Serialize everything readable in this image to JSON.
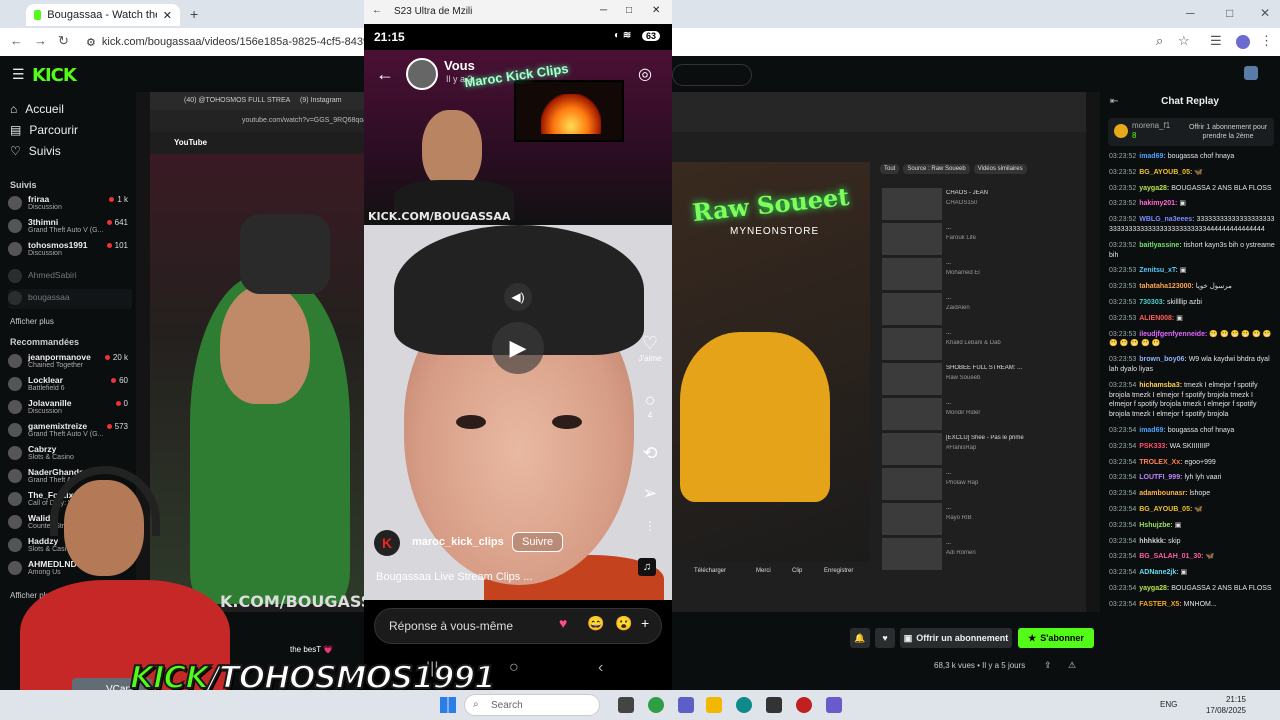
{
  "browser": {
    "tab1_title": "Bougassaa - Watch the VOD o",
    "url": "kick.com/bougassaa/videos/156e185a-9825-4cf5-8439-f83f774"
  },
  "kick": {
    "logo": "KICK",
    "nav": {
      "home": "Accueil",
      "browse": "Parcourir",
      "following": "Suivis"
    },
    "following_header": "Suivis",
    "following": [
      {
        "name": "friraa",
        "sub": "Discussion",
        "viewers": "1 k"
      },
      {
        "name": "3thimni",
        "sub": "Grand Theft Auto V (G...",
        "viewers": "641"
      },
      {
        "name": "tohosmos1991",
        "sub": "Discussion",
        "viewers": "101"
      },
      {
        "name": "AhmedSabiri",
        "sub": "",
        "viewers": ""
      },
      {
        "name": "bougassaa",
        "sub": "",
        "viewers": ""
      }
    ],
    "show_more": "Afficher plus",
    "recommended_header": "Recommandées",
    "recommended": [
      {
        "name": "jeanpormanove",
        "sub": "Chained Together",
        "viewers": "20 k"
      },
      {
        "name": "Locklear",
        "sub": "Battlefield 6",
        "viewers": "60"
      },
      {
        "name": "Jolavanille",
        "sub": "Discussion",
        "viewers": "0"
      },
      {
        "name": "gamemixtreize",
        "sub": "Grand Theft Auto V (G...",
        "viewers": "573"
      },
      {
        "name": "Cabrzy",
        "sub": "Slots & Casino",
        "viewers": ""
      },
      {
        "name": "NaderGhande",
        "sub": "Grand Theft Au",
        "viewers": ""
      },
      {
        "name": "The_Footix",
        "sub": "Call of Duty: W",
        "viewers": ""
      },
      {
        "name": "Walid",
        "sub": "Counter-Str",
        "viewers": ""
      },
      {
        "name": "Haddzy",
        "sub": "Slots & Casi",
        "viewers": ""
      },
      {
        "name": "AHMEDLNDY",
        "sub": "Among Us",
        "viewers": ""
      }
    ],
    "show_more2": "Afficher plus"
  },
  "inner_browser": {
    "tab1": "(40) @TOHOSMOS FULL STREA",
    "tab2": "(9) Instagram",
    "url": "youtube.com/watch?v=GGS_9RQ68qo&t",
    "yt_logo": "YouTube",
    "watermark": "K.COM/BOUGASSAA"
  },
  "right_window": {
    "neon": "Raw Soueet",
    "neon_sub": "MYNEONSTORE",
    "chips": [
      "Tout",
      "Source : Raw Soueeb",
      "Vidéos similaires"
    ],
    "list": [
      {
        "title": "CHAOS - JEAN",
        "meta": "CHAOS150"
      },
      {
        "title": "...",
        "meta": "Farouk Life"
      },
      {
        "title": "...",
        "meta": "Mohamed El"
      },
      {
        "title": "...",
        "meta": "ZaidAlen"
      },
      {
        "title": "...",
        "meta": "Khalid Lebani & Dab"
      },
      {
        "title": "SHOBEE FULL STREAM: ...",
        "meta": "Raw Soueeb"
      },
      {
        "title": "...",
        "meta": "Mondir Rider"
      },
      {
        "title": "[EXCLU] Shee - Pas le prime",
        "meta": "#FlanisRap"
      },
      {
        "title": "...",
        "meta": "Pholaw Rap"
      },
      {
        "title": "...",
        "meta": "Rayo RIB"
      },
      {
        "title": "...",
        "meta": "Adi Romen"
      }
    ],
    "bottom_actions": [
      "Télécharger",
      "Merci",
      "Clip",
      "Enregistrer"
    ]
  },
  "phone": {
    "window_title": "S23 Ultra de Mzili",
    "time": "21:15",
    "battery": "63",
    "story_user": "Vous",
    "story_time": "Il y a 2",
    "neon_sign": "Maroc Kick Clips",
    "cam_url": "KICK.COM/BOUGASSAA",
    "reel_author": "maroc_kick_clips",
    "follow": "Suivre",
    "caption": "Bougassaa Live Stream Clips ...",
    "like_label": "J'aime",
    "comment_count": "4",
    "reply_placeholder": "Réponse à vous-même"
  },
  "chat": {
    "title": "Chat Replay",
    "pinned_user": "morena_f1",
    "pinned_count": "8",
    "pinned_msg": "Offrir 1 abonnement pour prendre la 2ème",
    "messages": [
      {
        "ts": "03:23:52",
        "user": "imad69:",
        "color": "#4aa3ff",
        "text": "bougassa chof hnaya"
      },
      {
        "ts": "03:23:52",
        "user": "BG_AYOUB_05:",
        "color": "#f0c030",
        "text": "🦋"
      },
      {
        "ts": "03:23:52",
        "user": "yayga28:",
        "color": "#b7e34a",
        "text": "BOUGASSA 2 ANS BLA FLOSS"
      },
      {
        "ts": "03:23:52",
        "user": "hakimy201:",
        "color": "#ff6bd0",
        "text": "▣"
      },
      {
        "ts": "03:23:52",
        "user": "WBLG_na3eees:",
        "color": "#7f8cff",
        "text": "333333333333333333333333333333333333333333333444444444444444"
      },
      {
        "ts": "03:23:52",
        "user": "baitlyassine:",
        "color": "#6fe36f",
        "text": "tishort kayn3s bih o ystreame bih"
      },
      {
        "ts": "03:23:53",
        "user": "Zenitsu_xT:",
        "color": "#5ac8fa",
        "text": "▣"
      },
      {
        "ts": "03:23:53",
        "user": "tahataha123000:",
        "color": "#ffa64d",
        "text": "مرسول خويا"
      },
      {
        "ts": "03:23:53",
        "user": "730303:",
        "color": "#4fd3c4",
        "text": "skillllip azbi"
      },
      {
        "ts": "03:23:53",
        "user": "ALIEN008:",
        "color": "#ff5c5c",
        "text": "▣"
      },
      {
        "ts": "03:23:53",
        "user": "ileudjfgenfyenneide:",
        "color": "#e067ff",
        "text": "😬 😬 😬 😬 😬 😬 😬 😬 😬 😬 😬"
      },
      {
        "ts": "03:23:53",
        "user": "brown_boy06:",
        "color": "#8fb3ff",
        "text": "W9 wla kaydwi bhdra dyal lah dyalo liyas"
      },
      {
        "ts": "03:23:54",
        "user": "hichamsba3:",
        "color": "#ffd24a",
        "text": "tmezk I elmejor f spotify brojola tmezk I elmejor f spotify brojola tmezk I elmejor f spotify brojola tmezk I elmejor f spotify brojola tmezk I elmejor f spotify brojola"
      },
      {
        "ts": "03:23:54",
        "user": "imad69:",
        "color": "#4aa3ff",
        "text": "bougassa chof hnaya"
      },
      {
        "ts": "03:23:54",
        "user": "PSK333:",
        "color": "#ff4d6d",
        "text": "WA SKIIIIIIIP"
      },
      {
        "ts": "03:23:54",
        "user": "TROLEX_Xx:",
        "color": "#ff7f50",
        "text": "egoo+999"
      },
      {
        "ts": "03:23:54",
        "user": "LOUTFI_999:",
        "color": "#c084fc",
        "text": "lyh lyh vaari"
      },
      {
        "ts": "03:23:54",
        "user": "adambounasr:",
        "color": "#ffb347",
        "text": "lshope"
      },
      {
        "ts": "03:23:54",
        "user": "BG_AYOUB_05:",
        "color": "#f0c030",
        "text": "🦋"
      },
      {
        "ts": "03:23:54",
        "user": "Hshujzbe:",
        "color": "#9be15d",
        "text": "▣"
      },
      {
        "ts": "03:23:54",
        "user": "hhhkkk:",
        "color": "#cfcfcf",
        "text": "skip"
      },
      {
        "ts": "03:23:54",
        "user": "BG_SALAH_01_30:",
        "color": "#ff5fa2",
        "text": "🦋"
      },
      {
        "ts": "03:23:54",
        "user": "ADNane2jk:",
        "color": "#66d9ef",
        "text": "▣"
      },
      {
        "ts": "03:23:54",
        "user": "yayga28:",
        "color": "#b7e34a",
        "text": "BOUGASSA 2 ANS BLA FLOSS"
      },
      {
        "ts": "03:23:54",
        "user": "FASTER_X5:",
        "color": "#f5a623",
        "text": "MNHOM..."
      }
    ]
  },
  "actions": {
    "gift": "Offrir un abonnement",
    "subscribe": "S'abonner",
    "views": "68,3 k vues • Il y a 5 jours"
  },
  "webcam": {
    "overlay_kick": "KICK",
    "overlay_rest": "/TOHOSMOS1991",
    "vcam": "VCan",
    "best_text": "the besT 💗"
  },
  "taskbar": {
    "search": "Search",
    "lang": "ENG",
    "time": "21:15",
    "date": "17/08/2025"
  }
}
